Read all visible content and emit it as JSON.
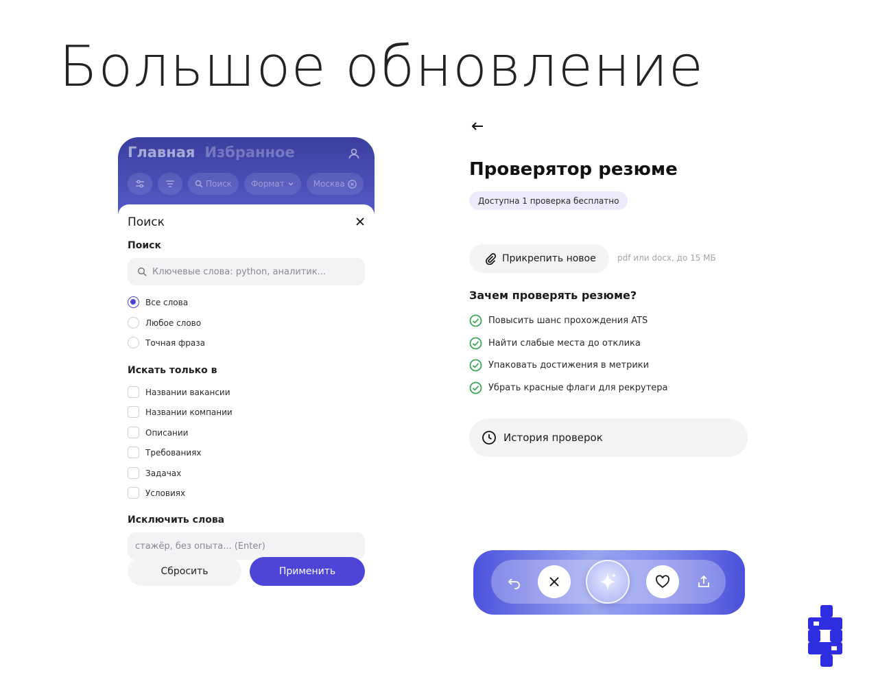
{
  "headline": "Большое обновление",
  "phone": {
    "tabs": {
      "main": "Главная",
      "favorites": "Избранное"
    },
    "chips": {
      "search": "Поиск",
      "format": "Формат",
      "city": "Москва"
    },
    "sheet": {
      "title": "Поиск",
      "search_section": "Поиск",
      "search_placeholder": "Ключевые слова: python, аналитик...",
      "match_options": [
        {
          "label": "Все слова",
          "selected": true
        },
        {
          "label": "Любое слово",
          "selected": false
        },
        {
          "label": "Точная фраза",
          "selected": false
        }
      ],
      "scope_section": "Искать только в",
      "scope_options": [
        {
          "label": "Названии вакансии",
          "checked": false
        },
        {
          "label": "Названии компании",
          "checked": false
        },
        {
          "label": "Описании",
          "checked": false
        },
        {
          "label": "Требованиях",
          "checked": false
        },
        {
          "label": "Задачах",
          "checked": false
        },
        {
          "label": "Условиях",
          "checked": false
        }
      ],
      "exclude_section": "Исключить слова",
      "exclude_placeholder": "стажёр, без опыта... (Enter)",
      "reset_label": "Сбросить",
      "apply_label": "Применить"
    }
  },
  "checker": {
    "title": "Проверятор резюме",
    "free_badge": "Доступна 1 проверка бесплатно",
    "attach_label": "Прикрепить новое",
    "attach_hint": "pdf или docx, до 15 МБ",
    "why_title": "Зачем проверять резюме?",
    "reasons": [
      "Повысить шанс прохождения ATS",
      "Найти слабые места до отклика",
      "Упаковать достижения в метрики",
      "Убрать красные флаги для рекрутера"
    ],
    "history_label": "История проверок"
  },
  "colors": {
    "accent": "#4d45d8",
    "check_green": "#3aa856",
    "panel_bg": "#f3f3f6",
    "brand": "#2f2de0"
  },
  "icons": {
    "back": "arrow-left-icon",
    "attach": "paperclip-icon",
    "history": "clock-icon",
    "undo": "undo-icon",
    "dislike": "close-icon",
    "ai": "sparkle-icon",
    "like": "heart-icon",
    "share": "share-icon"
  }
}
